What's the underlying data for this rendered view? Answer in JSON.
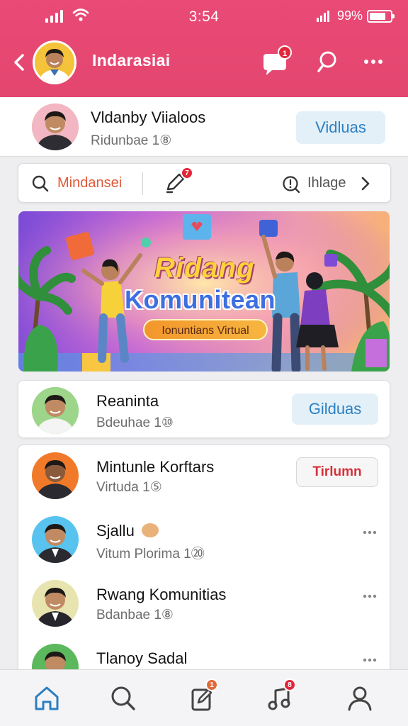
{
  "status": {
    "time": "3:54",
    "battery": "99%",
    "battery_level": 0.8
  },
  "header": {
    "title": "Indarasiai",
    "chat_badge": "1"
  },
  "profile": {
    "name": "Vldanby Viialoos",
    "sub": "Ridunbae 1⑧",
    "button": "Vidluas"
  },
  "search_row": {
    "search_label": "Mindansei",
    "pen_badge": "7",
    "image_label": "Ihlage"
  },
  "banner": {
    "title_line1": "Ridang",
    "title_line2": "Komunitean",
    "subtitle": "Ionuntians Virtual"
  },
  "card_top": {
    "name": "Reaninta",
    "sub": "Bdeuhae 1⑩",
    "button": "Gilduas"
  },
  "list": [
    {
      "name": "Mintunle Korftars",
      "sub": "Virtuda 1⑤",
      "button": "Tirlumn",
      "avatar_bg": "#f07a2a"
    },
    {
      "name": "Sjallu",
      "sub": "Vitum Plorima 1⑳",
      "avatar_bg": "#58c3ee"
    },
    {
      "name": "Rwang Komunitias",
      "sub": "Bdanbae 1⑧",
      "avatar_bg": "#e8e4b0"
    },
    {
      "name": "Tlanoy Sadal",
      "sub": "",
      "avatar_bg": "#5cb85c"
    }
  ],
  "nav": {
    "pen_badge": "1",
    "music_badge": "8"
  },
  "colors": {
    "header": "#e3466f",
    "accent_blue": "#2b7fc2",
    "badge_red": "#e3263a"
  }
}
